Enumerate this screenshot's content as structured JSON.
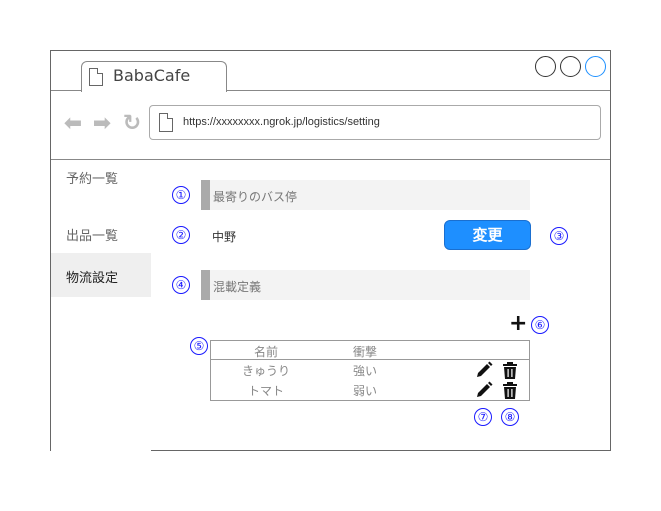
{
  "browser": {
    "tab_title": "BabaCafe",
    "url": "https://xxxxxxxx.ngrok.jp/logistics/setting",
    "accent": "#1e90ff"
  },
  "sidebar": {
    "items": [
      {
        "label": "予約一覧"
      },
      {
        "label": "出品一覧"
      },
      {
        "label": "物流設定",
        "active": true
      }
    ]
  },
  "bus_stop": {
    "heading": "最寄りのバス停",
    "value": "中野",
    "change_label": "変更"
  },
  "mixed_load": {
    "heading": "混載定義",
    "add_icon": "plus-icon",
    "table": {
      "headers": [
        "名前",
        "衝撃"
      ],
      "rows": [
        {
          "name": "きゅうり",
          "impact": "強い"
        },
        {
          "name": "トマト",
          "impact": "弱い"
        }
      ]
    }
  },
  "markers": [
    "①",
    "②",
    "③",
    "④",
    "⑤",
    "⑥",
    "⑦",
    "⑧"
  ],
  "colors": {
    "button": "#1e8fff",
    "marker": "#1a1aff"
  }
}
